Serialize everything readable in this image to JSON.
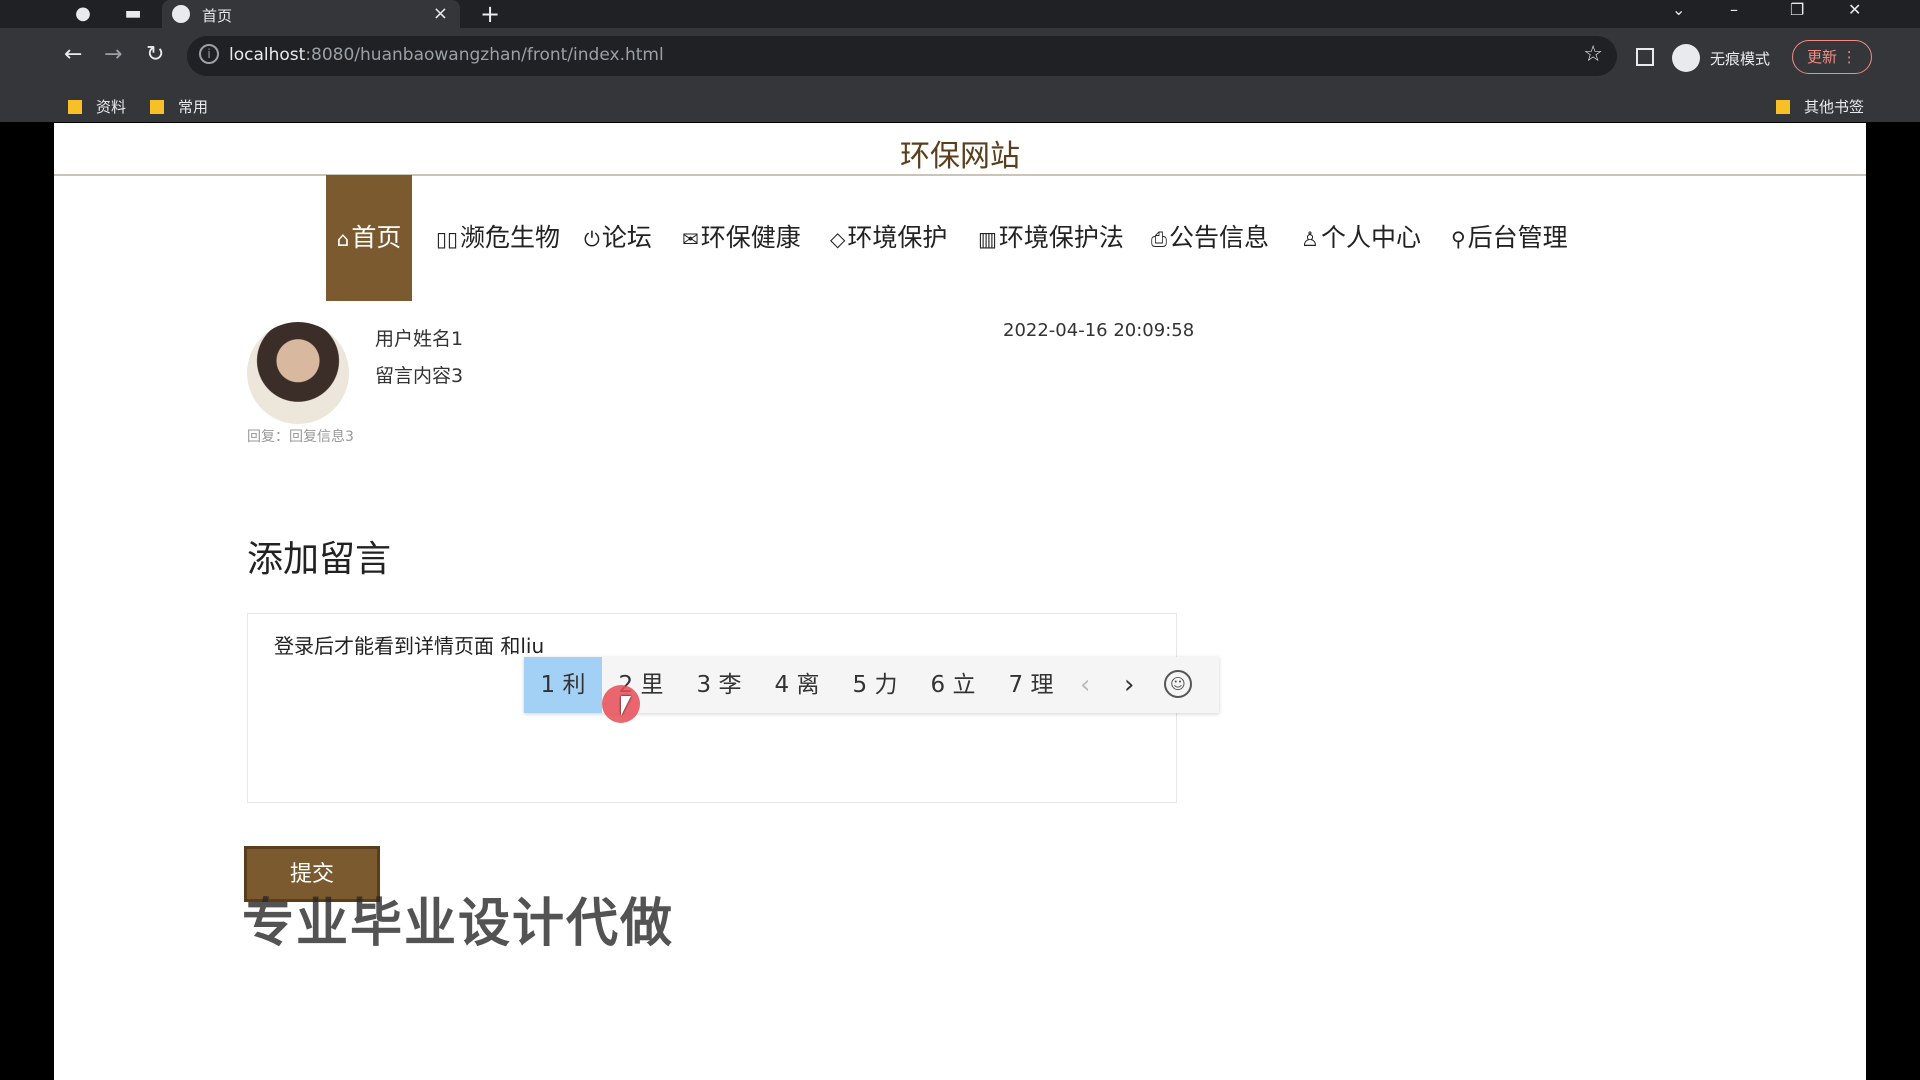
{
  "browser": {
    "tab_title": "首页",
    "new_tab_label": "+",
    "tab_close": "×",
    "url_host": "localhost",
    "url_path": ":8080/huanbaowangzhan/front/index.html",
    "incognito_label": "无痕模式",
    "update_label": "更新",
    "bookmarks": [
      "资料",
      "常用"
    ],
    "other_bookmarks": "其他书签",
    "icons": [
      "back-icon",
      "forward-icon",
      "reload-icon",
      "star-icon"
    ]
  },
  "site": {
    "title": "环保网站",
    "menu": [
      {
        "label": "首页",
        "icon": "⌂"
      },
      {
        "label": "濒危生物",
        "icon": "▯▯"
      },
      {
        "label": "论坛",
        "icon": "⏻"
      },
      {
        "label": "环保健康",
        "icon": "✉"
      },
      {
        "label": "环境保护",
        "icon": "◇"
      },
      {
        "label": "环境保护法",
        "icon": "▥"
      },
      {
        "label": "公告信息",
        "icon": "⎙"
      },
      {
        "label": "个人中心",
        "icon": "♙"
      },
      {
        "label": "后台管理",
        "icon": "⚲"
      }
    ],
    "accent_color": "#7b5a2f"
  },
  "message": {
    "user_name": "用户姓名1",
    "content": "留言内容3",
    "time": "2022-04-16 20:09:58",
    "reply": "回复：回复信息3"
  },
  "form": {
    "section_title": "添加留言",
    "typed_text": "登录后才能看到详情页面 和liu",
    "submit_label": "提交"
  },
  "ime": {
    "candidates": [
      "1 利",
      "2 里",
      "3 李",
      "4 离",
      "5 力",
      "6 立",
      "7 理"
    ],
    "prev": "‹",
    "next": "›",
    "emoji": "☺"
  },
  "watermark": "专业毕业设计代做"
}
